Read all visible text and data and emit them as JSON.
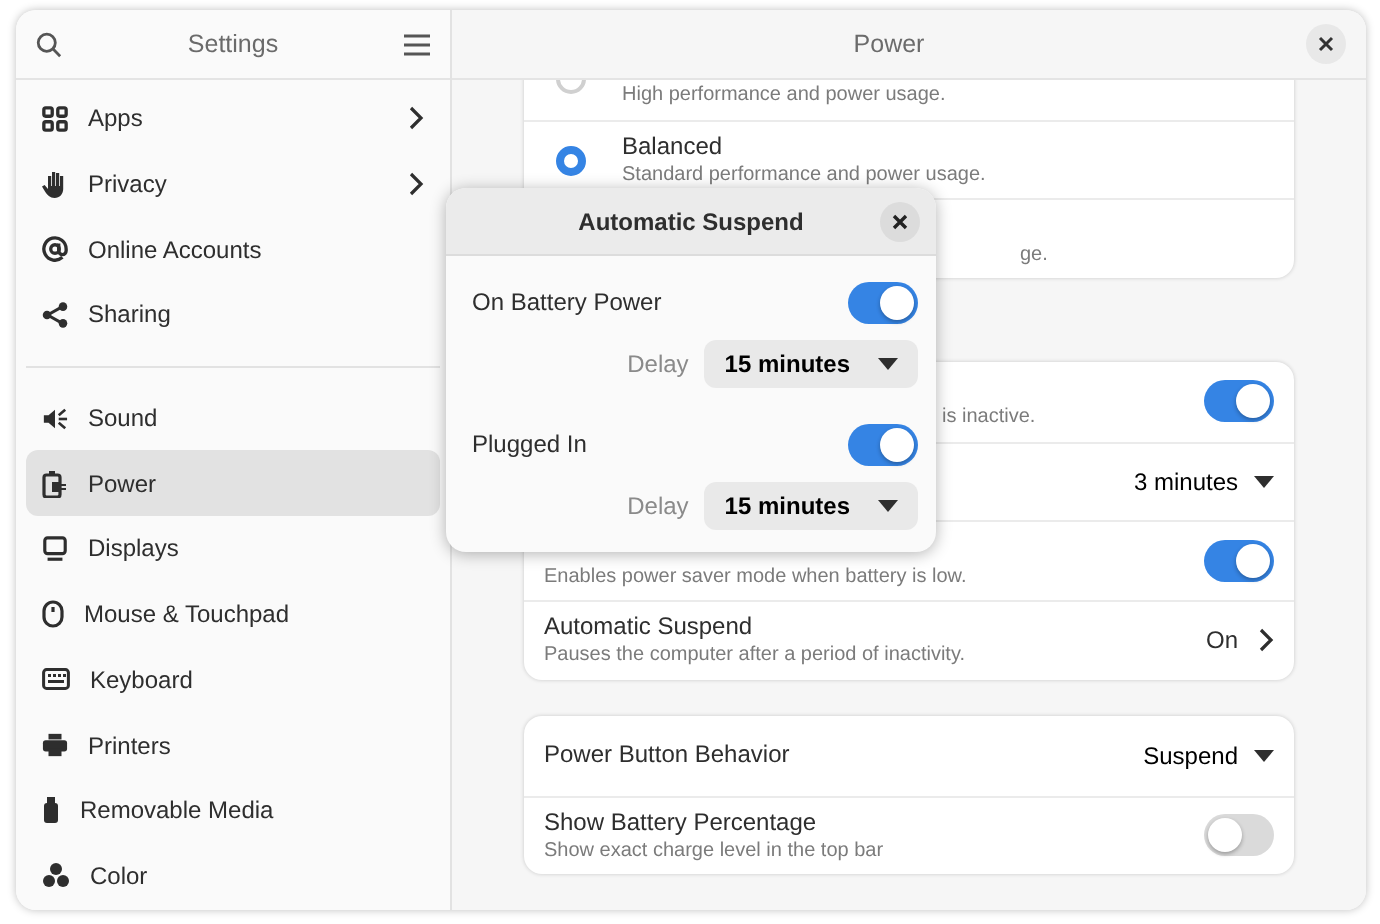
{
  "sidebar": {
    "title": "Settings",
    "groups": [
      [
        {
          "label": "Apps",
          "submenu": true,
          "selected": false
        },
        {
          "label": "Privacy",
          "submenu": true,
          "selected": false
        },
        {
          "label": "Online Accounts",
          "submenu": false,
          "selected": false
        },
        {
          "label": "Sharing",
          "submenu": false,
          "selected": false
        }
      ],
      [
        {
          "label": "Sound",
          "submenu": false,
          "selected": false
        },
        {
          "label": "Power",
          "submenu": false,
          "selected": true
        },
        {
          "label": "Displays",
          "submenu": false,
          "selected": false
        },
        {
          "label": "Mouse & Touchpad",
          "submenu": false,
          "selected": false
        },
        {
          "label": "Keyboard",
          "submenu": false,
          "selected": false
        },
        {
          "label": "Printers",
          "submenu": false,
          "selected": false
        },
        {
          "label": "Removable Media",
          "submenu": false,
          "selected": false
        },
        {
          "label": "Color",
          "submenu": false,
          "selected": false
        }
      ]
    ]
  },
  "page": {
    "title": "Power",
    "cards": [
      [
        {
          "kind": "radio",
          "subtitle": "High performance and power usage.",
          "selected": false
        },
        {
          "kind": "radio",
          "title": "Balanced",
          "subtitle": "Standard performance and power usage.",
          "selected": true
        },
        {
          "kind": "radio",
          "subtitle": "ge.",
          "covered": true
        }
      ],
      [
        {
          "kind": "toggle",
          "subtitle": "is inactive.",
          "covered": true,
          "on": true
        },
        {
          "kind": "dropdown",
          "value": "3 minutes"
        },
        {
          "kind": "toggle",
          "subtitle": "Enables power saver mode when battery is low.",
          "on": true
        },
        {
          "kind": "link",
          "title": "Automatic Suspend",
          "subtitle": "Pauses the computer after a period of inactivity.",
          "value": "On"
        }
      ],
      [
        {
          "kind": "dropdown",
          "title": "Power Button Behavior",
          "value": "Suspend"
        },
        {
          "kind": "toggle",
          "title": "Show Battery Percentage",
          "subtitle": "Show exact charge level in the top bar",
          "on": false
        }
      ]
    ]
  },
  "dialog": {
    "title": "Automatic Suspend",
    "sections": [
      {
        "label": "On Battery Power",
        "on": true,
        "delay_label": "Delay",
        "delay": "15 minutes"
      },
      {
        "label": "Plugged In",
        "on": true,
        "delay_label": "Delay",
        "delay": "15 minutes"
      }
    ]
  }
}
